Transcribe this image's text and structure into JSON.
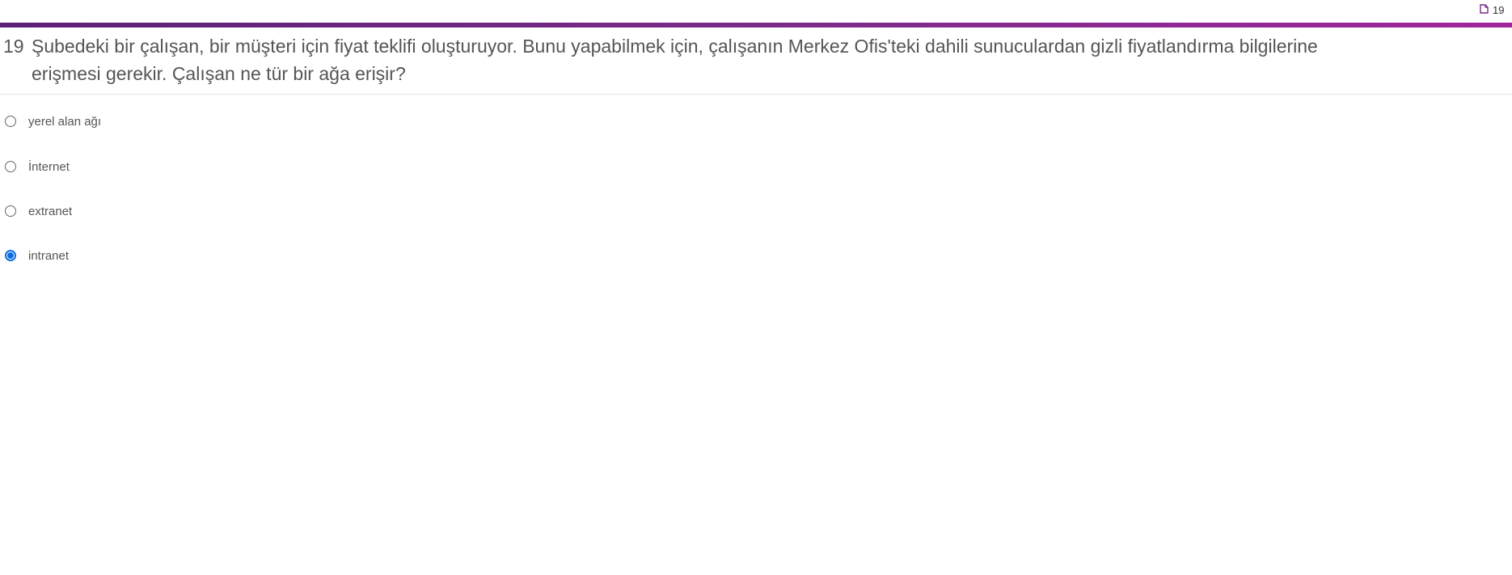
{
  "header": {
    "doc_icon": "document-icon",
    "question_count_partial": "19"
  },
  "colors": {
    "accent_bar_start": "#5c1f7a",
    "accent_bar_end": "#a0259a",
    "radio_selected": "#0b6ee0",
    "text": "#555555"
  },
  "question": {
    "number": "19",
    "text": "Şubedeki bir çalışan, bir müşteri için fiyat teklifi oluşturuyor. Bunu yapabilmek için, çalışanın Merkez Ofis'teki dahili sunuculardan gizli fiyatlandırma bilgilerine erişmesi gerekir. Çalışan ne tür bir ağa erişir?"
  },
  "options": [
    {
      "label": "yerel alan ağı",
      "selected": false
    },
    {
      "label": "İnternet",
      "selected": false
    },
    {
      "label": "extranet",
      "selected": false
    },
    {
      "label": "intranet",
      "selected": true
    }
  ]
}
